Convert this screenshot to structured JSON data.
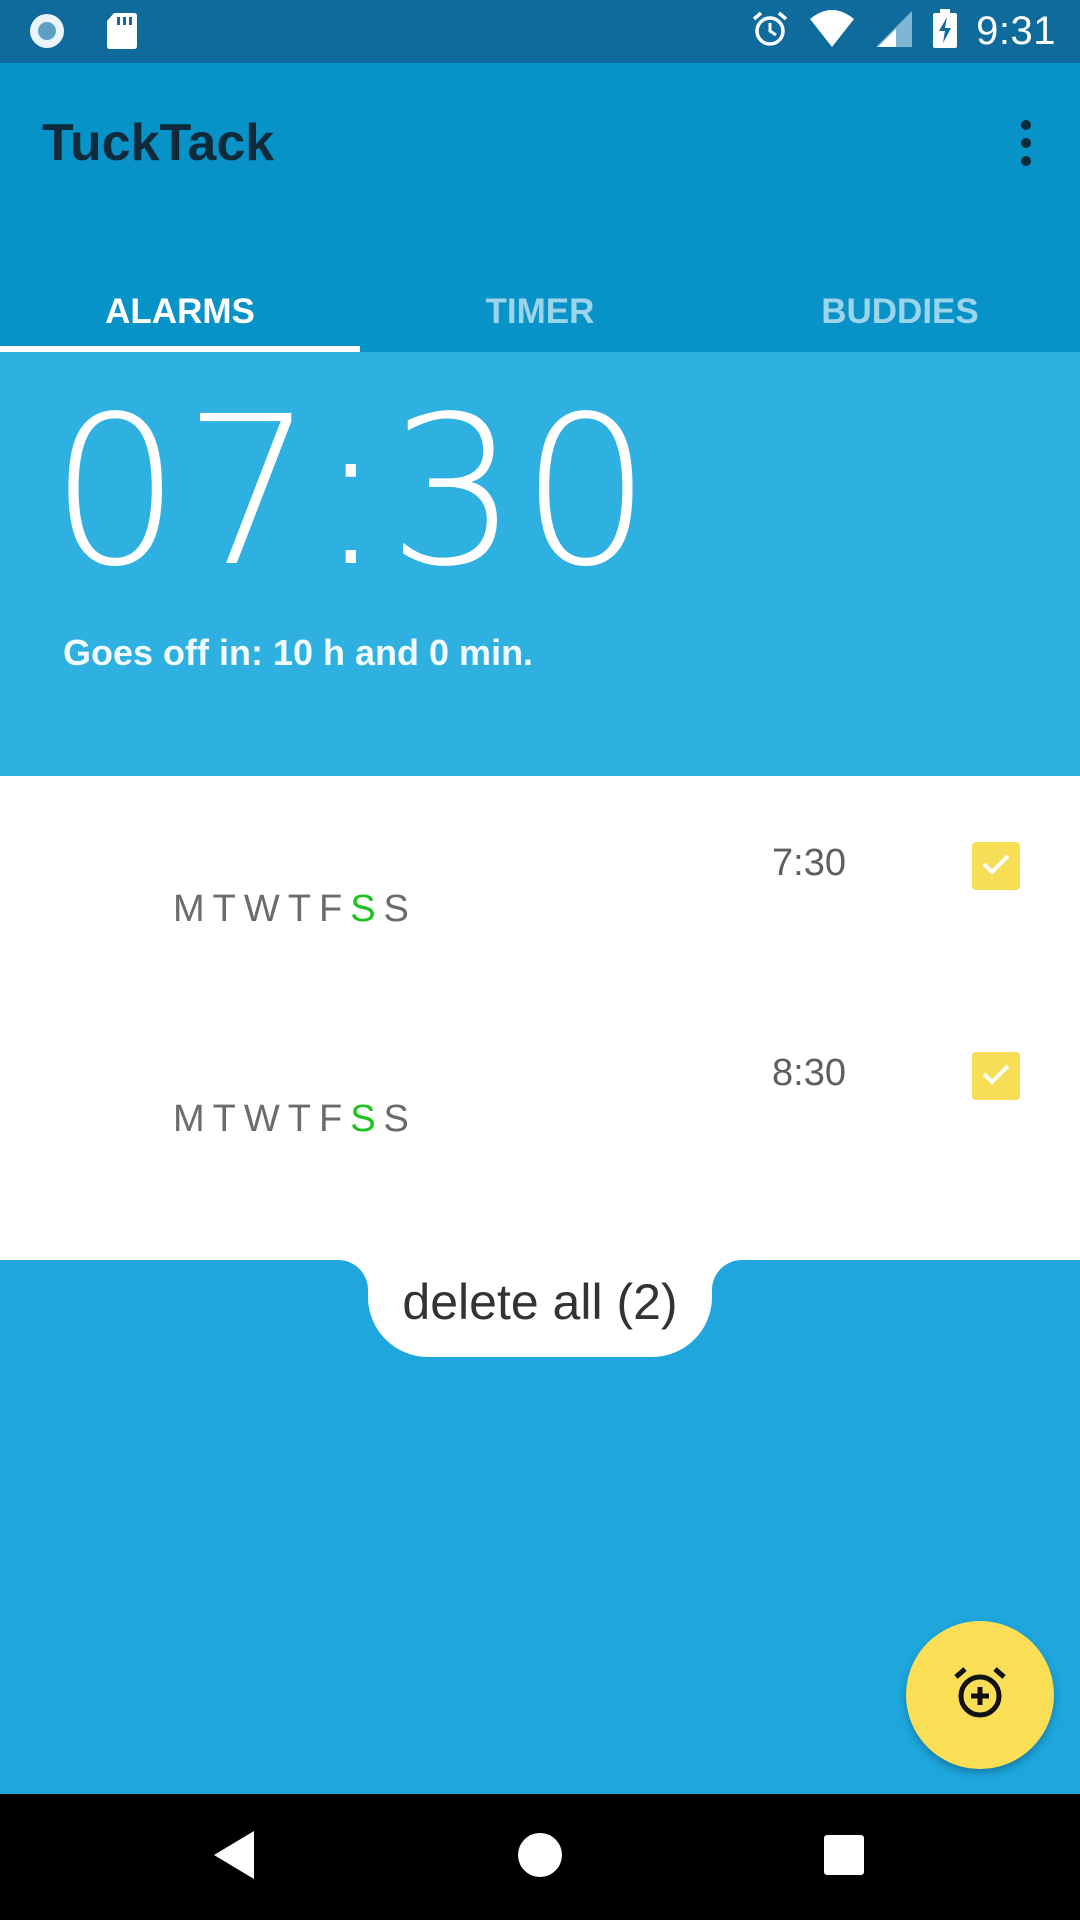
{
  "status_bar": {
    "time": "9:31",
    "left_icons": [
      "record-icon",
      "sd-card-icon"
    ],
    "right_icons": [
      "alarm-clock-icon",
      "wifi-icon",
      "cell-signal-icon",
      "battery-charging-icon"
    ]
  },
  "app_bar": {
    "title": "TuckTack",
    "overflow_icon": "more-vert-icon"
  },
  "tabs": [
    {
      "label": "ALARMS",
      "active": true
    },
    {
      "label": "TIMER",
      "active": false
    },
    {
      "label": "BUDDIES",
      "active": false
    }
  ],
  "next_alarm": {
    "time": "07:30",
    "goes_off": "Goes off in: 10 h and 0 min."
  },
  "alarms": [
    {
      "time": "7:30",
      "days": [
        "M",
        "T",
        "W",
        "T",
        "F",
        "S",
        "S"
      ],
      "active_days": [
        false,
        false,
        false,
        false,
        false,
        true,
        false
      ],
      "enabled": true
    },
    {
      "time": "8:30",
      "days": [
        "M",
        "T",
        "W",
        "T",
        "F",
        "S",
        "S"
      ],
      "active_days": [
        false,
        false,
        false,
        false,
        false,
        true,
        false
      ],
      "enabled": true
    }
  ],
  "delete_all_label": "delete all (2)",
  "fab_icon": "add-alarm-icon",
  "nav_bar": {
    "icons": [
      "back-icon",
      "home-icon",
      "recents-icon"
    ]
  },
  "colors": {
    "status_bar": "#0e6b9b",
    "app_bar": "#0893c8",
    "header": "#2eb1e1",
    "lower": "#1ea6dd",
    "accent_yellow": "#f6df57",
    "active_day": "#1ec21e"
  }
}
